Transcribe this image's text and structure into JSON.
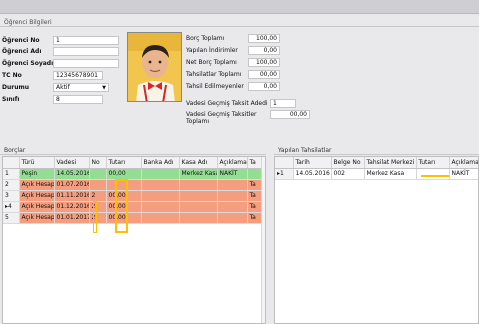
{
  "student": {
    "section_title": "Öğrenci Bilgileri",
    "fields": [
      {
        "label": "Öğrenci No",
        "value": "1"
      },
      {
        "label": "Öğrenci Adı",
        "value": ""
      },
      {
        "label": "Öğrenci Soyadı",
        "value": ""
      },
      {
        "label": "TC No",
        "value": "12345678901"
      },
      {
        "label": "Durumu",
        "value": "Aktif"
      },
      {
        "label": "Sınıfı",
        "value": "8"
      }
    ]
  },
  "summary": {
    "rows": [
      {
        "label": "Borç Toplamı",
        "value": "100,00"
      },
      {
        "label": "Yapılan İndirimler",
        "value": "0,00"
      },
      {
        "label": "Net Borç Toplamı",
        "value": "100,00"
      },
      {
        "label": "Tahsilatlar Toplamı",
        "value": "00,00"
      },
      {
        "label": "Tahsil Edilmeyenler",
        "value": "0,00"
      }
    ],
    "overdue_count_label": "Vadesi Geçmiş Taksit Adedi",
    "overdue_count_value": "1",
    "overdue_total_label": "Vadesi Geçmiş Taksitler Toplamı",
    "overdue_total_value": "00,00"
  },
  "debts": {
    "title": "Borçlar",
    "columns": [
      "Türü",
      "Vadesi",
      "No",
      "Tutarı",
      "Banka Adı",
      "Kasa Adı",
      "Açıklama",
      "Ta"
    ],
    "rows": [
      {
        "index": "1",
        "marker": "",
        "cells": [
          "Peşin",
          "14.05.2016",
          "",
          "00,00",
          "",
          "Merkez Kasa",
          "NAKİT",
          ""
        ],
        "color": "green"
      },
      {
        "index": "2",
        "marker": "",
        "cells": [
          "Açık Hesap",
          "01.07.2016",
          "",
          "",
          "",
          "",
          "",
          "Ta"
        ],
        "color": "salmon"
      },
      {
        "index": "3",
        "marker": "",
        "cells": [
          "Açık Hesap",
          "01.11.2016",
          "2",
          "00,00",
          "",
          "",
          "",
          "Ta"
        ],
        "color": "salmon"
      },
      {
        "index": "4",
        "marker": "▸",
        "cells": [
          "Açık Hesap",
          "01.12.2016",
          "2",
          "00,00",
          "",
          "",
          "",
          "Ta"
        ],
        "color": "salmon"
      },
      {
        "index": "5",
        "marker": "",
        "cells": [
          "Açık Hesap",
          "01.01.2017",
          "2",
          "00,00",
          "",
          "",
          "",
          "Ta"
        ],
        "color": "salmon"
      }
    ]
  },
  "payments": {
    "title": "Yapılan Tahsilatlar",
    "columns": [
      "Tarih",
      "Belge No",
      "Tahsilat Merkezi",
      "Tutarı",
      "Açıklama"
    ],
    "rows": [
      {
        "index": "1",
        "marker": "▸",
        "cells": [
          "14.05.2016",
          "002",
          "Merkez Kasa",
          "",
          "NAKİT"
        ]
      }
    ]
  },
  "colors": {
    "green_row": "#94de94",
    "salmon_row": "#f49d7f",
    "highlight": "#ffc000"
  }
}
